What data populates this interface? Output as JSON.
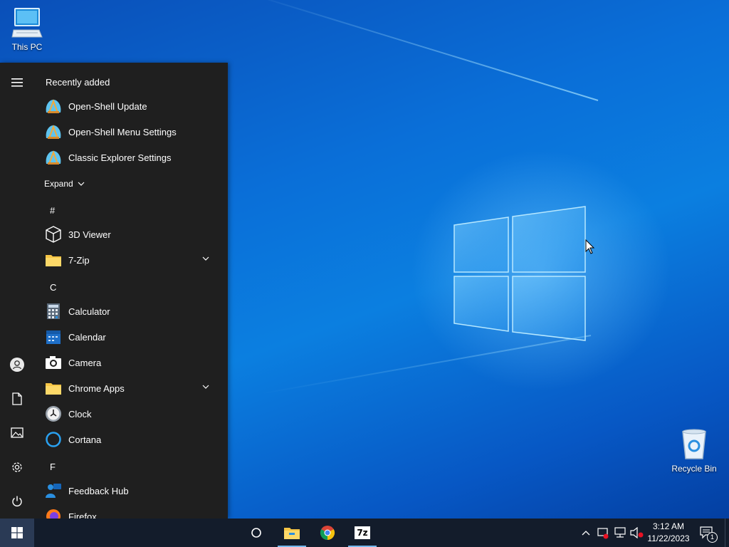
{
  "desktop": {
    "icons": [
      {
        "label": "This PC",
        "icon": "computer-icon"
      },
      {
        "label": "Recycle Bin",
        "icon": "recycle-bin-icon"
      }
    ]
  },
  "start_menu": {
    "recently_added_title": "Recently added",
    "recent_items": [
      {
        "label": "Open-Shell Update",
        "icon": "shell-icon"
      },
      {
        "label": "Open-Shell Menu Settings",
        "icon": "shell-icon"
      },
      {
        "label": "Classic Explorer Settings",
        "icon": "shell-icon"
      }
    ],
    "expand_label": "Expand",
    "groups": [
      {
        "letter": "#",
        "items": [
          {
            "label": "3D Viewer",
            "icon": "cube-icon",
            "expandable": false
          },
          {
            "label": "7-Zip",
            "icon": "folder-icon",
            "expandable": true
          }
        ]
      },
      {
        "letter": "C",
        "items": [
          {
            "label": "Calculator",
            "icon": "calculator-icon",
            "expandable": false
          },
          {
            "label": "Calendar",
            "icon": "calendar-icon",
            "expandable": false
          },
          {
            "label": "Camera",
            "icon": "camera-icon",
            "expandable": false
          },
          {
            "label": "Chrome Apps",
            "icon": "folder-icon",
            "expandable": true
          },
          {
            "label": "Clock",
            "icon": "clock-icon",
            "expandable": false
          },
          {
            "label": "Cortana",
            "icon": "cortana-icon",
            "expandable": false
          }
        ]
      },
      {
        "letter": "F",
        "items": [
          {
            "label": "Feedback Hub",
            "icon": "feedback-hub-icon",
            "expandable": false
          },
          {
            "label": "Firefox",
            "icon": "firefox-icon",
            "expandable": false
          }
        ]
      }
    ],
    "rail": [
      "hamburger-icon",
      "user-icon",
      "documents-icon",
      "pictures-icon",
      "settings-icon",
      "power-icon"
    ]
  },
  "taskbar": {
    "pinned": [
      "cortana-search-icon",
      "file-explorer-icon",
      "chrome-icon",
      "seven-zip-icon"
    ],
    "seven_zip_glyph": "7z",
    "tray": [
      "chevron-up-icon",
      "security-icon",
      "network-icon",
      "volume-muted-icon"
    ],
    "time": "3:12 AM",
    "date": "11/22/2023",
    "notification_count": "1"
  },
  "colors": {
    "accent": "#0078d7",
    "start_bg": "#1f1f1f",
    "taskbar_bg": "#131c2b",
    "folder_yellow": "#f6c545"
  }
}
